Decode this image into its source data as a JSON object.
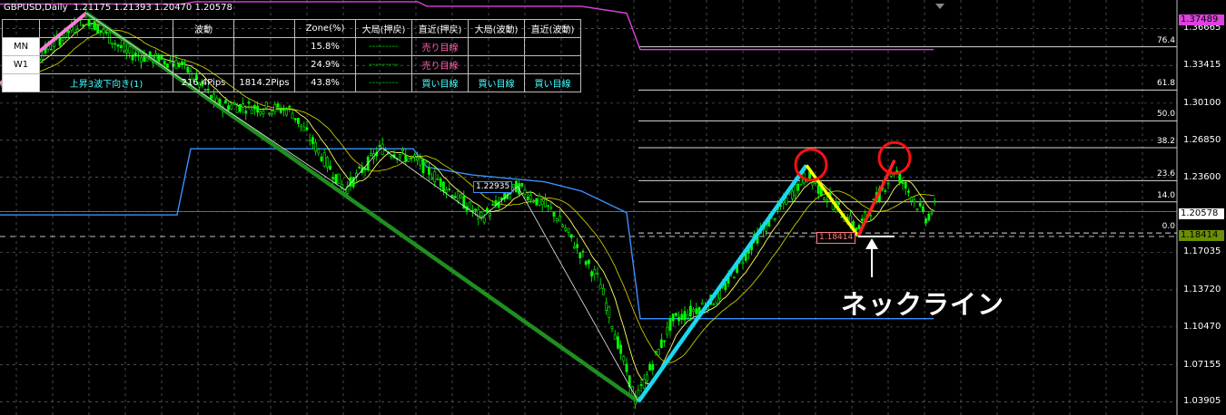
{
  "header": {
    "symbol": "GBPUSD,Daily",
    "ohlc": "1.21175 1.21393 1.20470 1.20578"
  },
  "table": {
    "headers": [
      "",
      "",
      "波動",
      "",
      "Zone(%)",
      "大局(押戻)",
      "直近(押戻)",
      "大局(波動)",
      "直近(波動)"
    ],
    "rows": [
      {
        "tf": "MN",
        "c1": "",
        "c2": "",
        "c3": "",
        "zone": "15.8%",
        "c5": "---------",
        "c6": "売り目線",
        "c7": "",
        "c8": ""
      },
      {
        "tf": "W1",
        "c1": "",
        "c2": "",
        "c3": "",
        "zone": "24.9%",
        "c5": "---------",
        "c6": "売り目線",
        "c7": "",
        "c8": ""
      },
      {
        "tf": "",
        "c1": "上昇3波下向き(1)",
        "c2": "216.4Pips",
        "c3": "1814.2Pips",
        "zone": "43.8%",
        "c5": "---------",
        "c6": "買い目線",
        "c7": "買い目線",
        "c8": "買い目線"
      }
    ]
  },
  "colors": {
    "buy": "#40ffff",
    "sell": "#ff5fb0",
    "neutral": "#00c000",
    "candle": "#00ff00",
    "ma_fast": "#ffff66",
    "ma_slow": "#c8c800",
    "zigzag_main": "#1f8f1f",
    "zigzag_up": "#19d9f0",
    "band": "#3a8fff",
    "band_upper": "#e040e0"
  },
  "chart_data": {
    "type": "candlestick",
    "symbol": "GBPUSD",
    "timeframe": "Daily",
    "ylim": [
      1.0275,
      1.3915
    ],
    "y_ticks": [
      1.36665,
      1.33415,
      1.301,
      1.2685,
      1.236,
      1.20578,
      1.17035,
      1.1372,
      1.1047,
      1.07155,
      1.03905
    ],
    "y_tick_labels": [
      "1.36665",
      "1.33415",
      "1.30100",
      "1.26850",
      "1.23600",
      "1.20578",
      "1.17035",
      "1.13720",
      "1.10470",
      "1.07155",
      "1.03905"
    ],
    "current_price": "1.20578",
    "upper_box": "1.37489",
    "lower_box": "1.18414",
    "fib_levels": [
      {
        "label": "76.4",
        "price": 1.3505
      },
      {
        "label": "61.8",
        "price": 1.3125
      },
      {
        "label": "50.0",
        "price": 1.2855
      },
      {
        "label": "38.2",
        "price": 1.262
      },
      {
        "label": "23.6",
        "price": 1.233
      },
      {
        "label": "14.0",
        "price": 1.2145
      },
      {
        "label": "0.0",
        "price": 1.1871
      }
    ],
    "labels_on_chart": {
      "high_mark": "1.22935",
      "neck_price": "1.18414"
    },
    "annotation": "ネックライン",
    "series": [
      {
        "name": "zigzag",
        "points": [
          [
            0,
            1.318
          ],
          [
            95,
            1.38
          ],
          [
            700,
            1.0392
          ],
          [
            888,
            1.2465
          ]
        ]
      },
      {
        "name": "up-leg",
        "points": [
          [
            703,
            1.0392
          ],
          [
            888,
            1.2465
          ]
        ]
      },
      {
        "name": "pullback",
        "points": [
          [
            888,
            1.2465
          ],
          [
            945,
            1.1845
          ]
        ]
      },
      {
        "name": "second-leg",
        "points": [
          [
            945,
            1.1845
          ],
          [
            985,
            1.251
          ]
        ]
      }
    ]
  }
}
